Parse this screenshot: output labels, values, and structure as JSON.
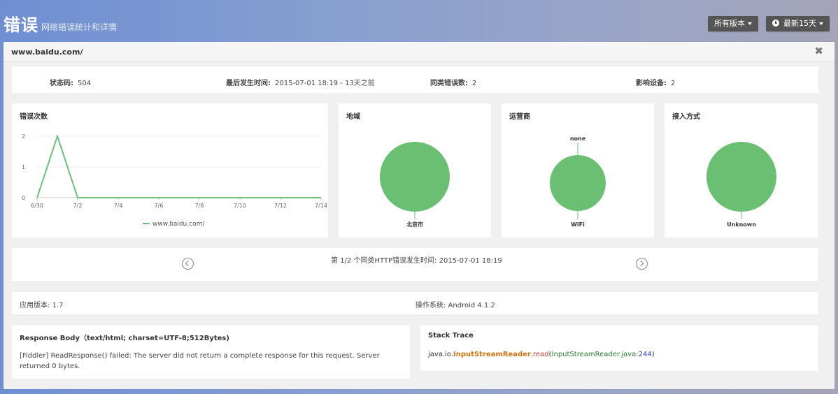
{
  "header": {
    "title": "错误",
    "subtitle": "网络错误统计和详情",
    "version_button": "所有版本",
    "time_button": "最新15天"
  },
  "panel": {
    "url": "www.baidu.com/",
    "close_icon": "✖"
  },
  "stats": {
    "status_code_label": "状态码:",
    "status_code_value": "504",
    "last_time_label": "最后发生时间:",
    "last_time_value": "2015-07-01 18:19 - 13天之前",
    "same_errors_label": "同类错误数:",
    "same_errors_value": "2",
    "devices_label": "影响设备:",
    "devices_value": "2"
  },
  "charts": {
    "error_count_title": "错误次数",
    "region_title": "地域",
    "carrier_title": "运营商",
    "access_title": "接入方式"
  },
  "chart_data": [
    {
      "type": "line",
      "title": "错误次数",
      "x_ticks": [
        "6/30",
        "7/2",
        "7/4",
        "7/6",
        "7/8",
        "7/10",
        "7/12",
        "7/14"
      ],
      "y_ticks": [
        "0",
        "1",
        "2"
      ],
      "ylim": [
        0,
        2
      ],
      "x": [
        "6/30",
        "7/1",
        "7/2",
        "7/3",
        "7/4",
        "7/5",
        "7/6",
        "7/7",
        "7/8",
        "7/9",
        "7/10",
        "7/11",
        "7/12",
        "7/13",
        "7/14"
      ],
      "series": [
        {
          "name": "www.baidu.com/",
          "color": "#6dbf7a",
          "values": [
            0,
            2,
            0,
            0,
            0,
            0,
            0,
            0,
            0,
            0,
            0,
            0,
            0,
            0,
            0
          ]
        }
      ],
      "grid": true,
      "legend": "bottom"
    },
    {
      "type": "pie",
      "title": "地域",
      "labels": [
        "北京市"
      ],
      "values": [
        1
      ],
      "color": "#6abf73"
    },
    {
      "type": "pie",
      "title": "运营商",
      "labels": [
        "none",
        "WiFi"
      ],
      "values": [
        0,
        1
      ],
      "color": "#6abf73"
    },
    {
      "type": "pie",
      "title": "接入方式",
      "labels": [
        "Unknown"
      ],
      "values": [
        1
      ],
      "color": "#6abf73"
    }
  ],
  "nav": {
    "text": "第 1/2 个同类HTTP错误发生时间: 2015-07-01 18:19"
  },
  "info": {
    "app_version": "应用版本: 1.7",
    "os": "操作系统: Android 4.1.2"
  },
  "response": {
    "title": "Response Body（text/html; charset=UTF-8;512Bytes)",
    "body": "[Fiddler] ReadResponse() failed: The server did not return a complete response for this request. Server returned 0 bytes."
  },
  "stack": {
    "title": "Stack Trace",
    "pkg": "java.io.",
    "cls": "InputStreamReader",
    "dot": ".",
    "method": "read",
    "open": "(",
    "file": "InputStreamReader.java:",
    "line": "244",
    "close": ")"
  },
  "colors": {
    "accent_green": "#6abf73",
    "header_blue": "#6f8fd3"
  }
}
